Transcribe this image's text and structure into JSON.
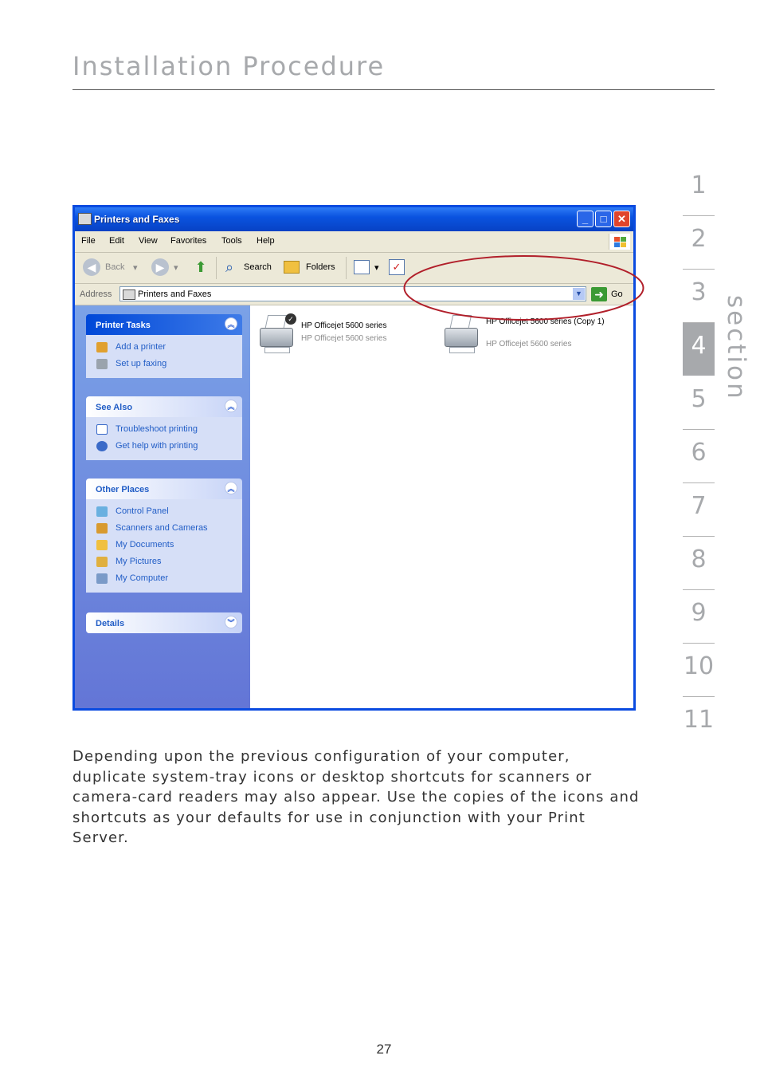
{
  "header": {
    "title": "Installation Procedure"
  },
  "section_nav": {
    "label": "section",
    "numbers": [
      "1",
      "2",
      "3",
      "4",
      "5",
      "6",
      "7",
      "8",
      "9",
      "10",
      "11"
    ],
    "active": "4"
  },
  "window": {
    "title": "Printers and Faxes",
    "menu": [
      "File",
      "Edit",
      "View",
      "Favorites",
      "Tools",
      "Help"
    ],
    "toolbar": {
      "back": "Back",
      "search": "Search",
      "folders": "Folders"
    },
    "address": {
      "label": "Address",
      "value": "Printers and Faxes",
      "go": "Go"
    },
    "task_pane": {
      "printer_tasks": {
        "title": "Printer Tasks",
        "items": [
          "Add a printer",
          "Set up faxing"
        ]
      },
      "see_also": {
        "title": "See Also",
        "items": [
          "Troubleshoot printing",
          "Get help with printing"
        ]
      },
      "other_places": {
        "title": "Other Places",
        "items": [
          "Control Panel",
          "Scanners and Cameras",
          "My Documents",
          "My Pictures",
          "My Computer"
        ]
      },
      "details": {
        "title": "Details"
      }
    },
    "printers": [
      {
        "name": "HP Officejet 5600 series",
        "model": "HP Officejet 5600 series",
        "default": true
      },
      {
        "name": "HP Officejet 5600 series (Copy 1)",
        "model": "HP Officejet 5600 series",
        "default": false
      }
    ]
  },
  "body_text": "Depending upon the previous configuration of your computer, duplicate system-tray icons or desktop shortcuts for scanners or camera-card readers may also appear. Use the copies of the icons and shortcuts as your defaults for use in conjunction with your Print Server.",
  "page_number": "27",
  "colors": {
    "accent_gray": "#a7a9ac",
    "xp_blue": "#0a4be0",
    "highlight_red": "#b11f2a"
  }
}
